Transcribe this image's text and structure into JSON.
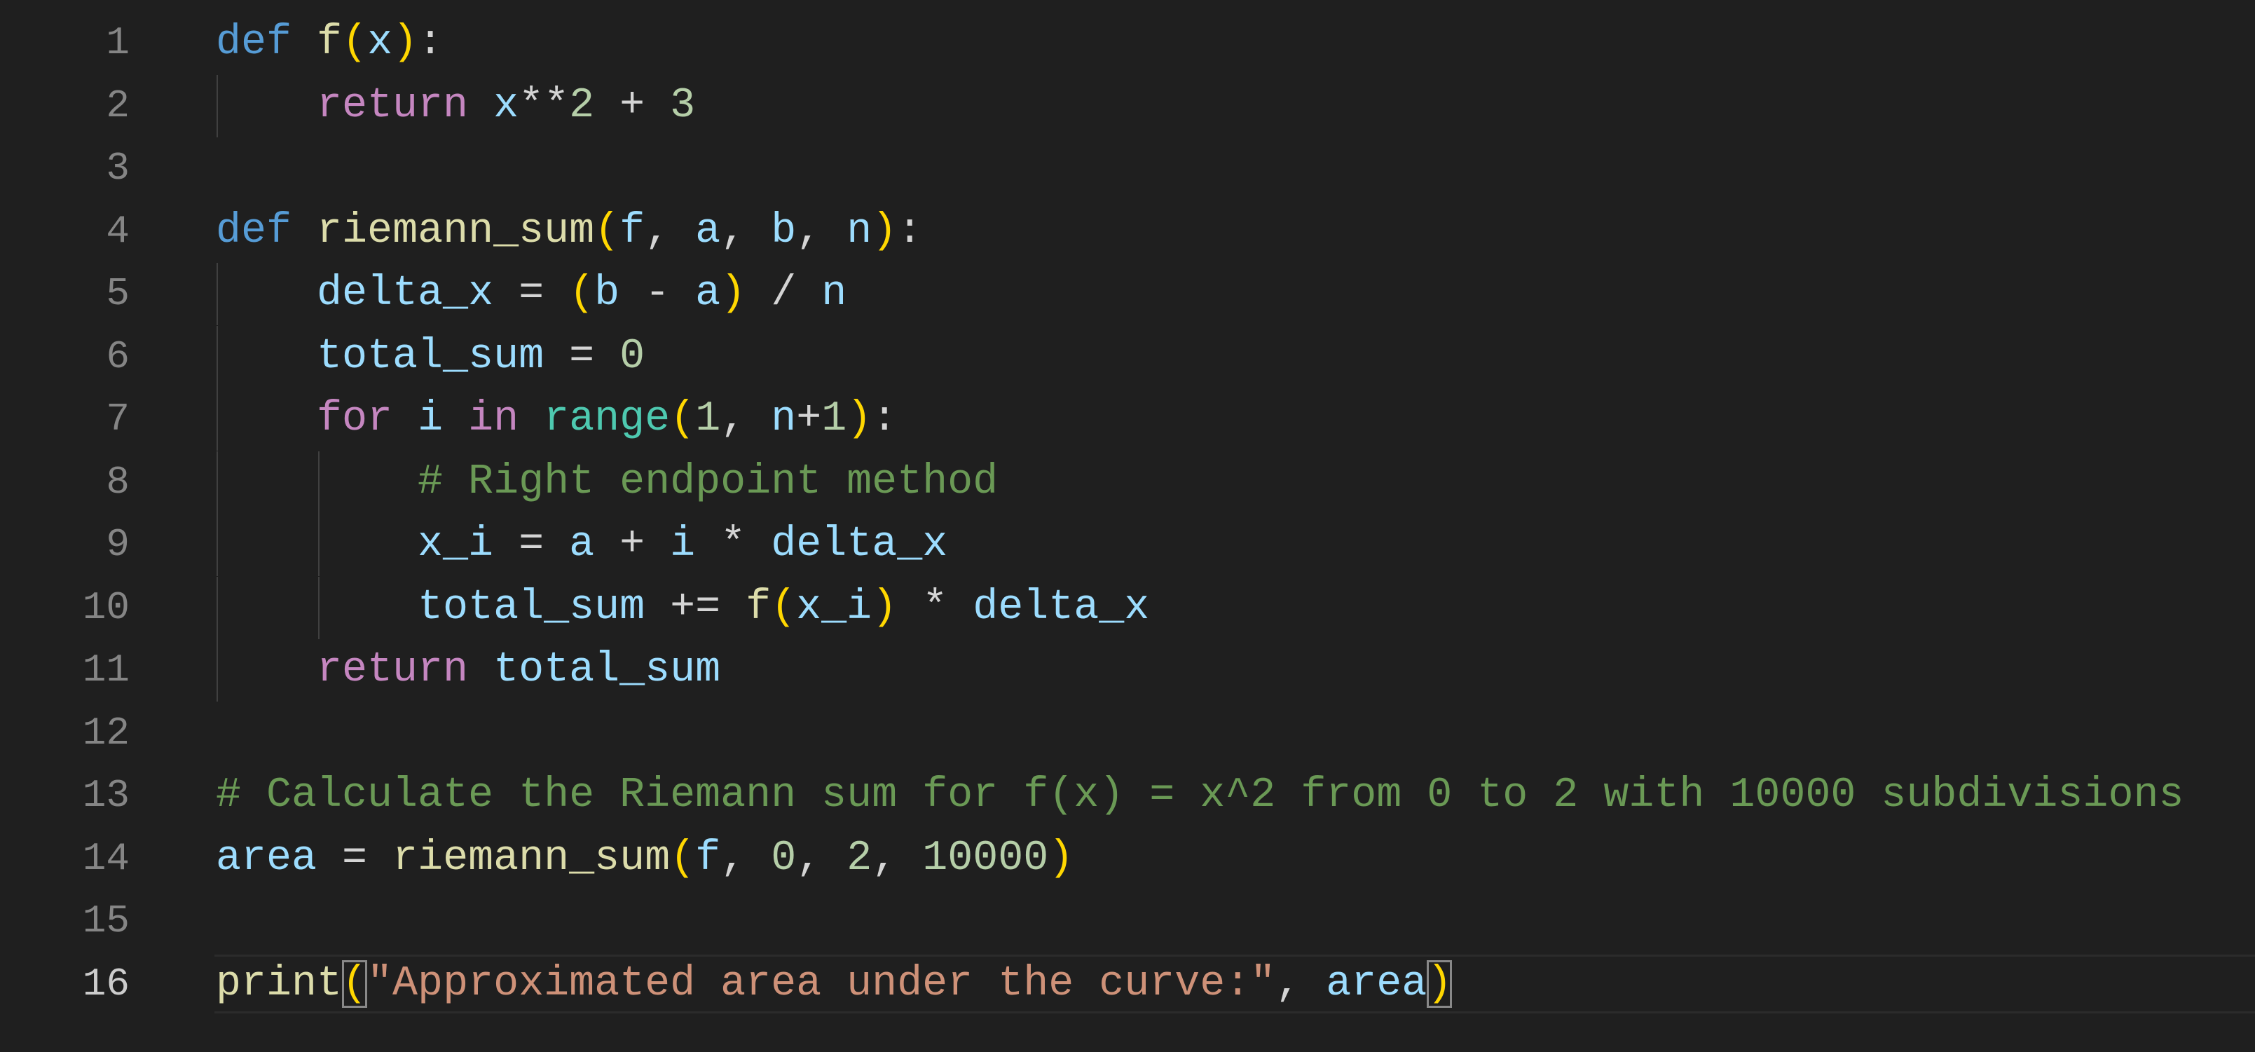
{
  "editor": {
    "language": "python",
    "active_line": 16,
    "colors": {
      "background": "#1f1f1f",
      "keyword": "#569cd6",
      "control": "#c586c0",
      "function": "#dcdcaa",
      "variable": "#9cdcfe",
      "bracket": "#ffd700",
      "number": "#b5cea8",
      "builtin": "#4ec9b0",
      "comment": "#6a9955",
      "string": "#ce9178",
      "line_number": "#858585"
    },
    "lines": [
      {
        "n": "1",
        "guides": 0,
        "tokens": [
          [
            "kw",
            "def"
          ],
          [
            "op",
            " "
          ],
          [
            "fn",
            "f"
          ],
          [
            "br",
            "("
          ],
          [
            "var",
            "x"
          ],
          [
            "br",
            ")"
          ],
          [
            "op",
            ":"
          ]
        ]
      },
      {
        "n": "2",
        "guides": 1,
        "tokens": [
          [
            "op",
            "    "
          ],
          [
            "ctl",
            "return"
          ],
          [
            "op",
            " "
          ],
          [
            "var",
            "x"
          ],
          [
            "op",
            "**"
          ],
          [
            "num",
            "2"
          ],
          [
            "op",
            " + "
          ],
          [
            "num",
            "3"
          ]
        ]
      },
      {
        "n": "3",
        "guides": 0,
        "tokens": []
      },
      {
        "n": "4",
        "guides": 0,
        "tokens": [
          [
            "kw",
            "def"
          ],
          [
            "op",
            " "
          ],
          [
            "fn",
            "riemann_sum"
          ],
          [
            "br",
            "("
          ],
          [
            "var",
            "f"
          ],
          [
            "op",
            ", "
          ],
          [
            "var",
            "a"
          ],
          [
            "op",
            ", "
          ],
          [
            "var",
            "b"
          ],
          [
            "op",
            ", "
          ],
          [
            "var",
            "n"
          ],
          [
            "br",
            ")"
          ],
          [
            "op",
            ":"
          ]
        ]
      },
      {
        "n": "5",
        "guides": 1,
        "tokens": [
          [
            "op",
            "    "
          ],
          [
            "var",
            "delta_x"
          ],
          [
            "op",
            " = "
          ],
          [
            "br",
            "("
          ],
          [
            "var",
            "b"
          ],
          [
            "op",
            " - "
          ],
          [
            "var",
            "a"
          ],
          [
            "br",
            ")"
          ],
          [
            "op",
            " / "
          ],
          [
            "var",
            "n"
          ]
        ]
      },
      {
        "n": "6",
        "guides": 1,
        "tokens": [
          [
            "op",
            "    "
          ],
          [
            "var",
            "total_sum"
          ],
          [
            "op",
            " = "
          ],
          [
            "num",
            "0"
          ]
        ]
      },
      {
        "n": "7",
        "guides": 1,
        "tokens": [
          [
            "op",
            "    "
          ],
          [
            "ctl",
            "for"
          ],
          [
            "op",
            " "
          ],
          [
            "var",
            "i"
          ],
          [
            "op",
            " "
          ],
          [
            "ctl",
            "in"
          ],
          [
            "op",
            " "
          ],
          [
            "cls",
            "range"
          ],
          [
            "br",
            "("
          ],
          [
            "num",
            "1"
          ],
          [
            "op",
            ", "
          ],
          [
            "var",
            "n"
          ],
          [
            "op",
            "+"
          ],
          [
            "num",
            "1"
          ],
          [
            "br",
            ")"
          ],
          [
            "op",
            ":"
          ]
        ]
      },
      {
        "n": "8",
        "guides": 2,
        "tokens": [
          [
            "op",
            "        "
          ],
          [
            "cmt",
            "# Right endpoint method"
          ]
        ]
      },
      {
        "n": "9",
        "guides": 2,
        "tokens": [
          [
            "op",
            "        "
          ],
          [
            "var",
            "x_i"
          ],
          [
            "op",
            " = "
          ],
          [
            "var",
            "a"
          ],
          [
            "op",
            " + "
          ],
          [
            "var",
            "i"
          ],
          [
            "op",
            " * "
          ],
          [
            "var",
            "delta_x"
          ]
        ]
      },
      {
        "n": "10",
        "guides": 2,
        "tokens": [
          [
            "op",
            "        "
          ],
          [
            "var",
            "total_sum"
          ],
          [
            "op",
            " += "
          ],
          [
            "fn",
            "f"
          ],
          [
            "br",
            "("
          ],
          [
            "var",
            "x_i"
          ],
          [
            "br",
            ")"
          ],
          [
            "op",
            " * "
          ],
          [
            "var",
            "delta_x"
          ]
        ]
      },
      {
        "n": "11",
        "guides": 1,
        "tokens": [
          [
            "op",
            "    "
          ],
          [
            "ctl",
            "return"
          ],
          [
            "op",
            " "
          ],
          [
            "var",
            "total_sum"
          ]
        ]
      },
      {
        "n": "12",
        "guides": 0,
        "tokens": []
      },
      {
        "n": "13",
        "guides": 0,
        "tokens": [
          [
            "cmt",
            "# Calculate the Riemann sum for f(x) = x^2 from 0 to 2 with 10000 subdivisions"
          ]
        ]
      },
      {
        "n": "14",
        "guides": 0,
        "tokens": [
          [
            "var",
            "area"
          ],
          [
            "op",
            " = "
          ],
          [
            "fn",
            "riemann_sum"
          ],
          [
            "br",
            "("
          ],
          [
            "var",
            "f"
          ],
          [
            "op",
            ", "
          ],
          [
            "num",
            "0"
          ],
          [
            "op",
            ", "
          ],
          [
            "num",
            "2"
          ],
          [
            "op",
            ", "
          ],
          [
            "num",
            "10000"
          ],
          [
            "br",
            ")"
          ]
        ]
      },
      {
        "n": "15",
        "guides": 0,
        "tokens": []
      },
      {
        "n": "16",
        "guides": 0,
        "tokens": [
          [
            "fn",
            "print"
          ],
          [
            "br match",
            "("
          ],
          [
            "str",
            "\"Approximated area under the curve:\""
          ],
          [
            "op",
            ", "
          ],
          [
            "var",
            "area"
          ],
          [
            "br match",
            ")"
          ]
        ]
      }
    ]
  }
}
